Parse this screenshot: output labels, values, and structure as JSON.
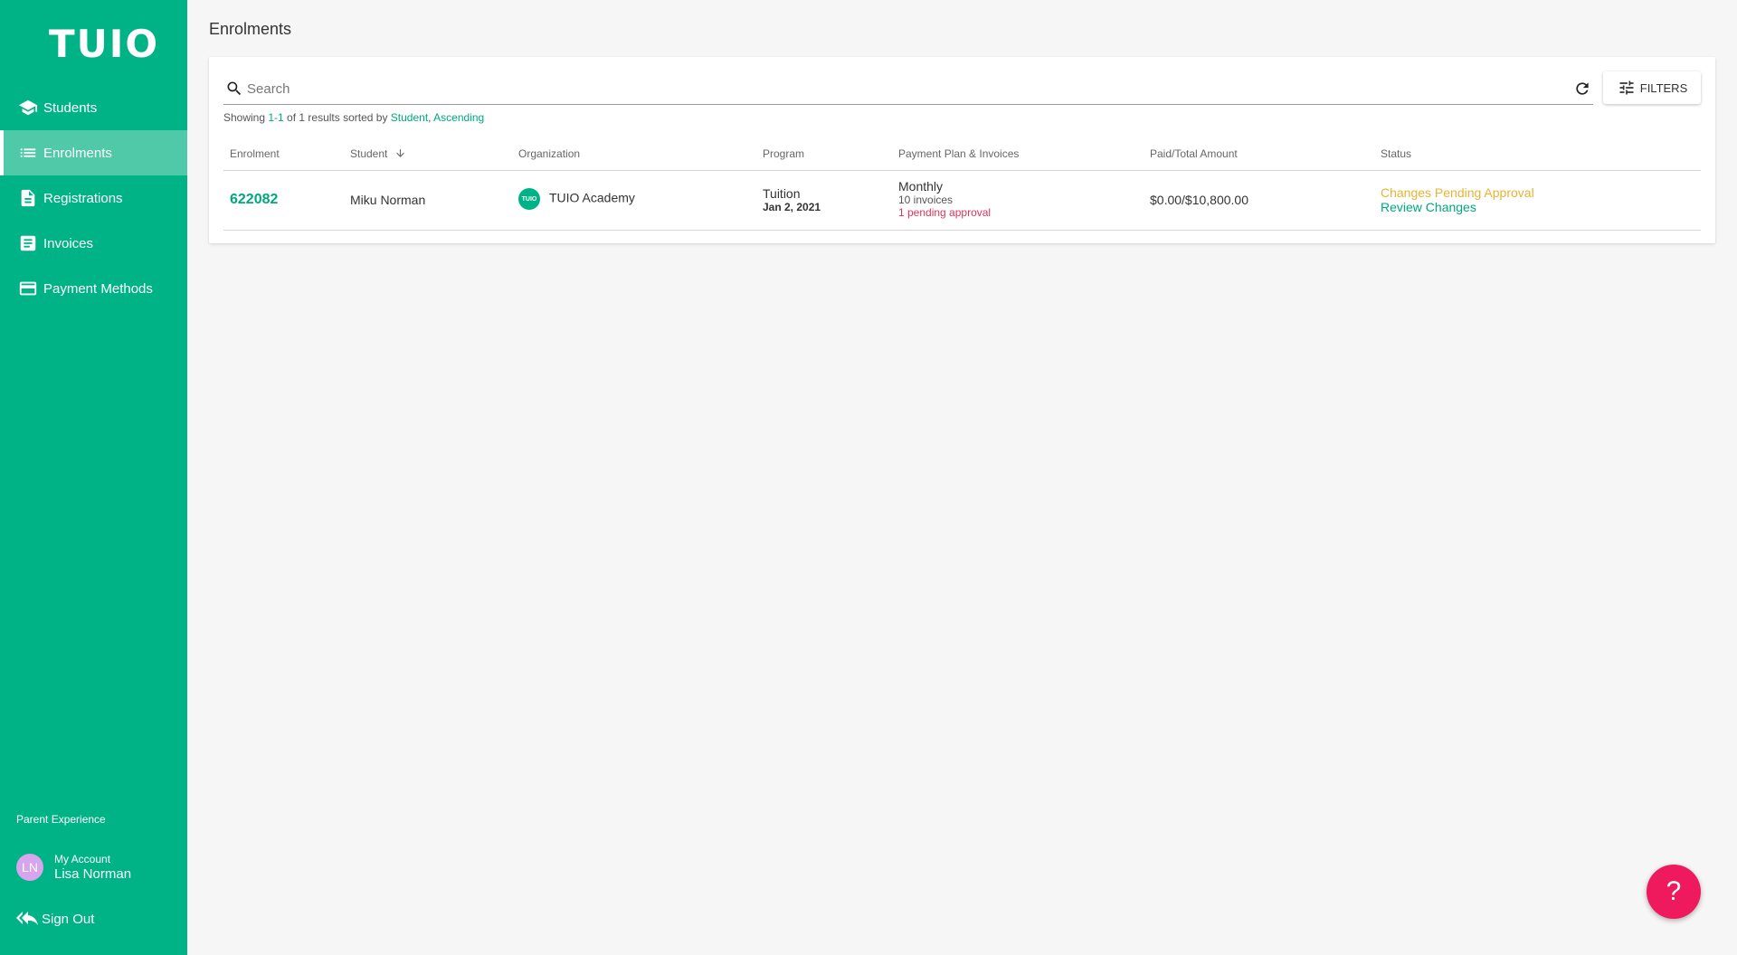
{
  "brand": {
    "logo_text": "TUIO",
    "color": "#00b386"
  },
  "sidebar": {
    "items": [
      {
        "label": "Students",
        "icon": "graduation-cap-icon"
      },
      {
        "label": "Enrolments",
        "icon": "list-icon",
        "active": true
      },
      {
        "label": "Registrations",
        "icon": "document-icon"
      },
      {
        "label": "Invoices",
        "icon": "invoice-icon"
      },
      {
        "label": "Payment Methods",
        "icon": "credit-card-icon"
      }
    ],
    "section_label": "Parent Experience",
    "account": {
      "label": "My Account",
      "name": "Lisa Norman",
      "initials": "LN"
    },
    "sign_out": "Sign Out"
  },
  "page": {
    "title": "Enrolments"
  },
  "search": {
    "placeholder": "Search",
    "value": ""
  },
  "filters_label": "FILTERS",
  "summary": {
    "prefix": "Showing ",
    "range": "1-1",
    "middle": " of 1 results sorted by ",
    "sort_field": "Student",
    "separator": ", ",
    "sort_order": "Ascending"
  },
  "table": {
    "headers": [
      "Enrolment",
      "Student",
      "Organization",
      "Program",
      "Payment Plan & Invoices",
      "Paid/Total Amount",
      "Status"
    ],
    "rows": [
      {
        "enrolment": "622082",
        "student": "Miku Norman",
        "organization": "TUIO Academy",
        "org_logo_text": "TUIO",
        "program": "Tuition",
        "program_date": "Jan 2, 2021",
        "plan": "Monthly",
        "invoices": "10 invoices",
        "pending": "1 pending approval",
        "amount": "$0.00/$10,800.00",
        "status": "Changes Pending Approval",
        "status_action": "Review Changes"
      }
    ]
  },
  "help": {
    "label": "?"
  },
  "colors": {
    "accent": "#00b386",
    "link": "#00a87e",
    "warning": "#e8b333",
    "danger": "#e0325a",
    "help": "#ef1a5e"
  }
}
